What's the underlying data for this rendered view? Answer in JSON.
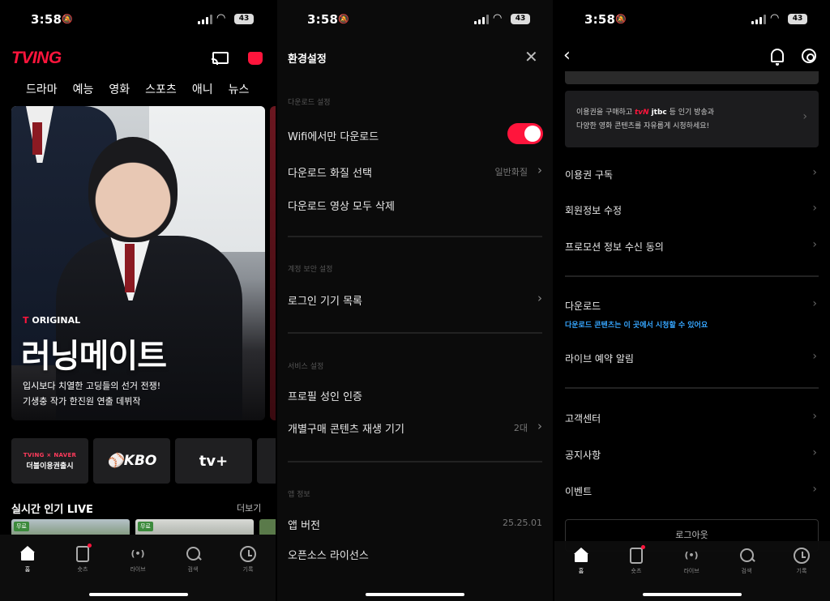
{
  "status_time": "3:58",
  "battery": "43",
  "home": {
    "logo": "TVING",
    "categories": [
      "드라마",
      "예능",
      "영화",
      "스포츠",
      "애니",
      "뉴스"
    ],
    "hero": {
      "badge_prefix": "T",
      "badge": "ORIGINAL",
      "title": "러닝메이트",
      "desc_line1": "입시보다 치열한 고딩들의 선거 전쟁!",
      "desc_line2": "기생충 작가 한진원 연출 데뷔작"
    },
    "chips": [
      {
        "line1": "TVING × NAVER",
        "line2": "더블이용권출시"
      },
      {
        "label": "KBO"
      },
      {
        "label": "tv+"
      }
    ],
    "live_title": "실시간 인기 LIVE",
    "more": "더보기",
    "thumb_badge": "무료",
    "tabs": [
      "홈",
      "숏츠",
      "라이브",
      "검색",
      "기록"
    ]
  },
  "settings": {
    "title": "환경설정",
    "sections": {
      "download": "다운로드 설정",
      "account": "계정 보안 설정",
      "service": "서비스 설정",
      "app": "앱 정보"
    },
    "rows": {
      "wifi_only": "Wifi에서만 다운로드",
      "quality": "다운로드 화질 선택",
      "quality_value": "일반화질",
      "delete_all": "다운로드 영상 모두 삭제",
      "login_devices": "로그인 기기 목록",
      "adult_auth": "프로필 성인 인증",
      "devices": "개별구매 콘텐츠 재생 기기",
      "devices_value": "2대",
      "version": "앱 버전",
      "version_value": "25.25.01",
      "license": "오픈소스 라이선스"
    }
  },
  "mypage": {
    "promo_line1_a": "이용권을 구매하고",
    "promo_tvn": "tvN",
    "promo_jtbc": "jtbc",
    "promo_line1_b": "등 인기 방송과",
    "promo_line2": "다양한 영화 콘텐츠를 자유롭게 시청하세요!",
    "menu": {
      "subscribe": "이용권 구독",
      "profile_edit": "회원정보 수정",
      "promo_consent": "프로모션 정보 수신 동의",
      "download": "다운로드",
      "download_sub": "다운로드 콘텐츠는 이 곳에서 시청할 수 있어요",
      "live_alarm": "라이브 예약 알림",
      "support": "고객센터",
      "notice": "공지사항",
      "event": "이벤트"
    },
    "logout": "로그아웃"
  },
  "colors": {
    "brand": "#ff153c",
    "accent_blue": "#36a6ff"
  }
}
